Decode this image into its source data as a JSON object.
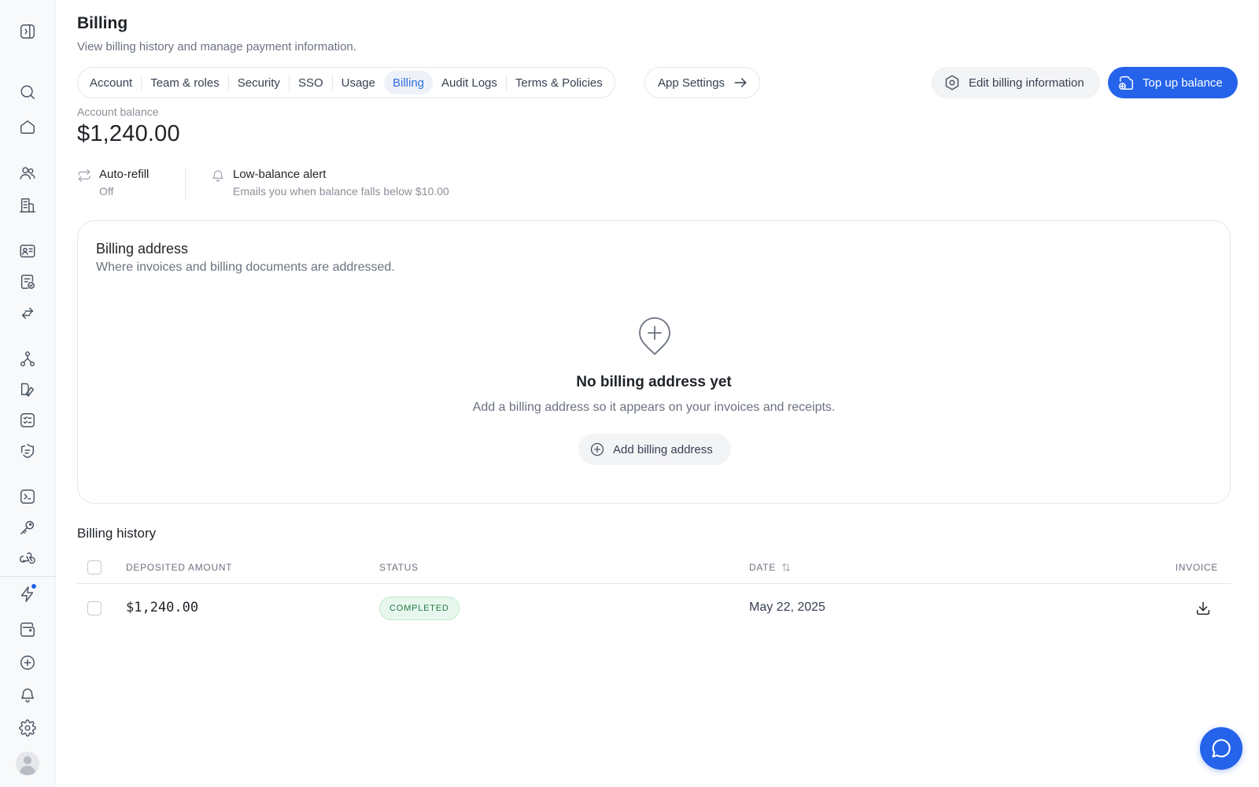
{
  "page": {
    "title": "Billing",
    "subtitle": "View billing history and manage payment information."
  },
  "tabs": [
    {
      "label": "Account"
    },
    {
      "label": "Team & roles"
    },
    {
      "label": "Security"
    },
    {
      "label": "SSO"
    },
    {
      "label": "Usage"
    },
    {
      "label": "Billing",
      "active": true
    },
    {
      "label": "Audit Logs"
    },
    {
      "label": "Terms & Policies"
    }
  ],
  "app_settings": {
    "label": "App Settings",
    "icon": "arrow-right-icon"
  },
  "actions": {
    "edit_label": "Edit billing information",
    "topup_label": "Top up balance"
  },
  "balance": {
    "label": "Account balance",
    "value": "$1,240.00"
  },
  "features": {
    "auto_refill": {
      "title": "Auto-refill",
      "value": "Off",
      "icon": "refresh-icon"
    },
    "alert": {
      "title": "Low-balance alert",
      "value": "Emails you when balance falls below $10.00",
      "icon": "bell-icon"
    }
  },
  "billing_address": {
    "title": "Billing address",
    "subtitle": "Where invoices and billing documents are addressed.",
    "empty_title": "No billing address yet",
    "empty_subtitle": "Add a billing address so it appears on your invoices and receipts.",
    "add_label": "Add billing address"
  },
  "history": {
    "title": "Billing history",
    "columns": [
      "DEPOSITED AMOUNT",
      "STATUS",
      "DATE",
      "INVOICE"
    ],
    "rows": [
      {
        "amount": "$1,240.00",
        "status": "COMPLETED",
        "date": "May 22, 2025"
      }
    ]
  },
  "colors": {
    "accent": "#2563eb",
    "active_tab_text": "#2f6fdb",
    "status_completed": "#217a45"
  },
  "sidebar_icons": [
    "sidebar-toggle-icon",
    "search-icon",
    "home-icon",
    "users-icon",
    "building-icon",
    "contact-card-icon",
    "document-check-icon",
    "transfer-icon",
    "workflow-icon",
    "book-icon",
    "checklist-icon",
    "shield-icon",
    "terminal-icon",
    "key-icon",
    "webhook-icon",
    "lightning-icon",
    "wallet-icon",
    "plus-circle-icon",
    "bell-icon",
    "gear-icon",
    "avatar"
  ]
}
